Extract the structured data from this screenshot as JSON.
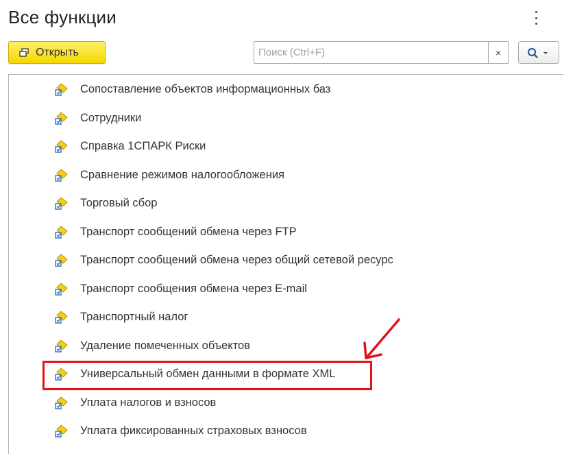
{
  "header": {
    "title": "Все функции",
    "more_icon": "more-vertical-icon"
  },
  "toolbar": {
    "open_label": "Открыть",
    "open_icon": "open-window-icon",
    "search_placeholder": "Поиск (Ctrl+F)",
    "search_value": "",
    "clear_label": "×",
    "search_icon": "search-icon",
    "dropdown_icon": "chevron-down-icon"
  },
  "list": {
    "items": [
      {
        "label": "Сопоставление объектов информационных баз",
        "icon": "data-processor-icon"
      },
      {
        "label": "Сотрудники",
        "icon": "data-processor-icon"
      },
      {
        "label": "Справка 1СПАРК Риски",
        "icon": "data-processor-icon"
      },
      {
        "label": "Сравнение режимов налогообложения",
        "icon": "data-processor-icon"
      },
      {
        "label": "Торговый сбор",
        "icon": "data-processor-icon"
      },
      {
        "label": "Транспорт сообщений обмена через FTP",
        "icon": "data-processor-icon"
      },
      {
        "label": "Транспорт сообщений обмена через общий сетевой ресурс",
        "icon": "data-processor-icon"
      },
      {
        "label": "Транспорт сообщения обмена через E-mail",
        "icon": "data-processor-icon"
      },
      {
        "label": "Транспортный налог",
        "icon": "data-processor-icon"
      },
      {
        "label": "Удаление помеченных объектов",
        "icon": "data-processor-icon"
      },
      {
        "label": "Универсальный обмен данными в формате XML",
        "icon": "data-processor-icon"
      },
      {
        "label": "Уплата налогов и взносов",
        "icon": "data-processor-icon"
      },
      {
        "label": "Уплата фиксированных страховых взносов",
        "icon": "data-processor-icon"
      }
    ]
  },
  "annotation": {
    "highlight_color": "#e3111b",
    "arrow_color": "#e3111b"
  },
  "colors": {
    "open_button": "#f5d800",
    "icon_yellow": "#f2cf1a",
    "icon_blue": "#2f6fb5"
  }
}
